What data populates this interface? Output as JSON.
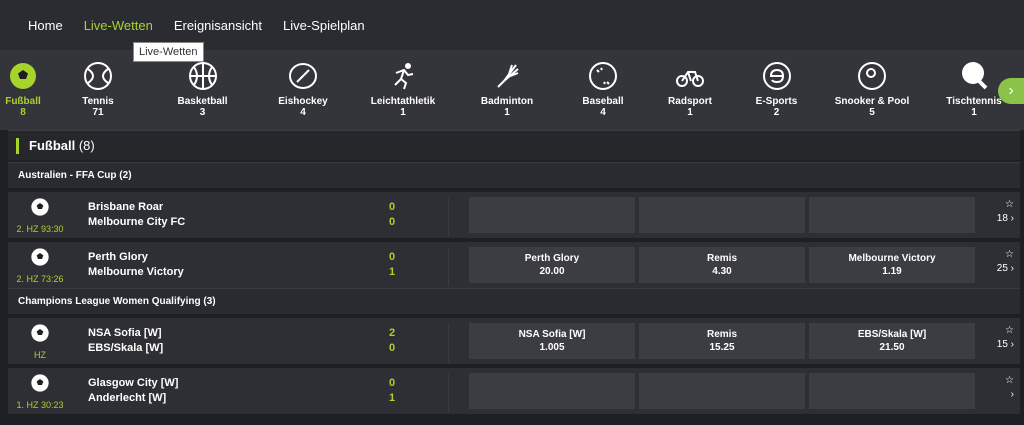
{
  "nav": {
    "items": [
      {
        "label": "Home",
        "active": false
      },
      {
        "label": "Live-Wetten",
        "active": true
      },
      {
        "label": "Ereignisansicht",
        "active": false
      },
      {
        "label": "Live-Spielplan",
        "active": false
      }
    ],
    "tooltip": "Live-Wetten"
  },
  "sports": [
    {
      "label": "Fußball",
      "count": "8",
      "icon": "soccer-ball-icon",
      "active": true
    },
    {
      "label": "Tennis",
      "count": "71",
      "icon": "tennis-ball-icon"
    },
    {
      "label": "Basketball",
      "count": "3",
      "icon": "basketball-icon"
    },
    {
      "label": "Eishockey",
      "count": "4",
      "icon": "hockey-puck-icon"
    },
    {
      "label": "Leichtathletik",
      "count": "1",
      "icon": "runner-icon"
    },
    {
      "label": "Badminton",
      "count": "1",
      "icon": "shuttlecock-icon"
    },
    {
      "label": "Baseball",
      "count": "4",
      "icon": "baseball-icon"
    },
    {
      "label": "Radsport",
      "count": "1",
      "icon": "bicycle-icon"
    },
    {
      "label": "E-Sports",
      "count": "2",
      "icon": "esports-icon"
    },
    {
      "label": "Snooker & Pool",
      "count": "5",
      "icon": "snooker-ball-icon"
    },
    {
      "label": "Tischtennis",
      "count": "1",
      "icon": "table-tennis-icon"
    }
  ],
  "category": {
    "label": "Fußball",
    "count": "(8)"
  },
  "leagues": [
    {
      "name": "Australien - FFA Cup (2)",
      "matches": [
        {
          "time": "2. HZ 93:30",
          "home": "Brisbane Roar",
          "away": "Melbourne City FC",
          "score_home": "0",
          "score_away": "0",
          "odds": [],
          "more": "18"
        },
        {
          "time": "2. HZ 73:26",
          "home": "Perth Glory",
          "away": "Melbourne Victory",
          "score_home": "0",
          "score_away": "1",
          "odds": [
            {
              "label": "Perth Glory",
              "value": "20.00"
            },
            {
              "label": "Remis",
              "value": "4.30"
            },
            {
              "label": "Melbourne Victory",
              "value": "1.19"
            }
          ],
          "more": "25"
        }
      ]
    },
    {
      "name": "Champions League Women Qualifying (3)",
      "matches": [
        {
          "time": "HZ",
          "home": "NSA Sofia [W]",
          "away": "EBS/Skala [W]",
          "score_home": "2",
          "score_away": "0",
          "odds": [
            {
              "label": "NSA Sofia [W]",
              "value": "1.005"
            },
            {
              "label": "Remis",
              "value": "15.25"
            },
            {
              "label": "EBS/Skala [W]",
              "value": "21.50"
            }
          ],
          "more": "15"
        },
        {
          "time": "1. HZ 30:23",
          "home": "Glasgow City [W]",
          "away": "Anderlecht [W]",
          "score_home": "0",
          "score_away": "1",
          "odds": [],
          "more": ""
        }
      ]
    }
  ],
  "colors": {
    "accent": "#a6d32c",
    "bg": "#1e1f22"
  }
}
